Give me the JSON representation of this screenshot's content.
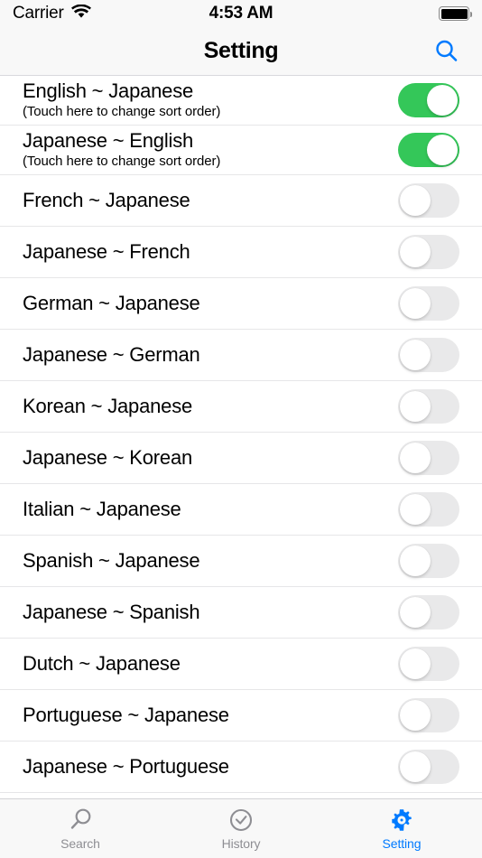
{
  "status_bar": {
    "carrier": "Carrier",
    "wifi_icon": "wifi-icon",
    "time": "4:53 AM",
    "battery_icon": "battery-full-icon"
  },
  "nav_bar": {
    "title": "Setting",
    "search_icon": "search-icon",
    "accent_color": "#007AFF"
  },
  "colors": {
    "toggle_on": "#34C759",
    "toggle_off": "#E9E9EA",
    "accent": "#007AFF",
    "inactive_tab": "#8E8E93",
    "separator": "#E6E6E8",
    "bar_background": "#F8F8F8"
  },
  "list": {
    "rows": [
      {
        "title": "English ~ Japanese",
        "subtitle": "(Touch here to change sort order)",
        "enabled": true
      },
      {
        "title": "Japanese ~ English",
        "subtitle": "(Touch here to change sort order)",
        "enabled": true
      },
      {
        "title": "French ~ Japanese",
        "subtitle": "",
        "enabled": false
      },
      {
        "title": "Japanese ~ French",
        "subtitle": "",
        "enabled": false
      },
      {
        "title": "German ~ Japanese",
        "subtitle": "",
        "enabled": false
      },
      {
        "title": "Japanese ~ German",
        "subtitle": "",
        "enabled": false
      },
      {
        "title": "Korean ~ Japanese",
        "subtitle": "",
        "enabled": false
      },
      {
        "title": "Japanese ~ Korean",
        "subtitle": "",
        "enabled": false
      },
      {
        "title": "Italian ~ Japanese",
        "subtitle": "",
        "enabled": false
      },
      {
        "title": "Spanish ~ Japanese",
        "subtitle": "",
        "enabled": false
      },
      {
        "title": "Japanese ~ Spanish",
        "subtitle": "",
        "enabled": false
      },
      {
        "title": "Dutch ~ Japanese",
        "subtitle": "",
        "enabled": false
      },
      {
        "title": "Portuguese ~ Japanese",
        "subtitle": "",
        "enabled": false
      },
      {
        "title": "Japanese ~ Portuguese",
        "subtitle": "",
        "enabled": false
      }
    ]
  },
  "tab_bar": {
    "tabs": [
      {
        "label": "Search",
        "icon": "magnifier-icon",
        "active": false
      },
      {
        "label": "History",
        "icon": "clock-check-icon",
        "active": false
      },
      {
        "label": "Setting",
        "icon": "gear-icon",
        "active": true
      }
    ]
  }
}
